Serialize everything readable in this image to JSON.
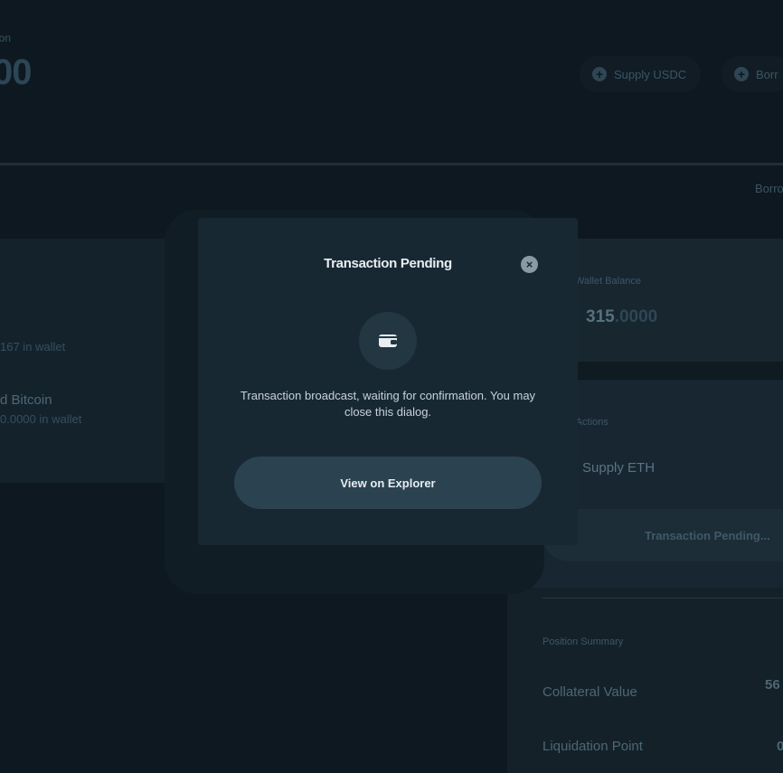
{
  "header": {
    "label": "ion",
    "value": "00",
    "supply_label": "Supply USDC",
    "borrow_label": "Borr"
  },
  "tabs": {
    "borrow": "Borro"
  },
  "assets": [
    {
      "name": "",
      "wallet": "167 in wallet"
    },
    {
      "name": "d Bitcoin",
      "wallet": "0.0000 in wallet"
    }
  ],
  "right_panel": {
    "wallet_title": "Wallet Balance",
    "balance_int": "315",
    "balance_dec": ".0000",
    "actions_title": "ng Actions",
    "supply_eth": "Supply ETH",
    "pending_button": "Transaction Pending...",
    "summary_title": "Position Summary",
    "collateral_label": "Collateral Value",
    "collateral_value": "56",
    "liquidation_label": "Liquidation Point",
    "liquidation_value": "0"
  },
  "modal": {
    "title": "Transaction Pending",
    "message": "Transaction broadcast, waiting for confirmation. You may close this dialog.",
    "explorer_button": "View on Explorer",
    "icon": "wallet-icon",
    "close_icon": "close-icon"
  },
  "colors": {
    "background": "#0e1820",
    "modal": "#182832",
    "button": "#2b4250"
  }
}
